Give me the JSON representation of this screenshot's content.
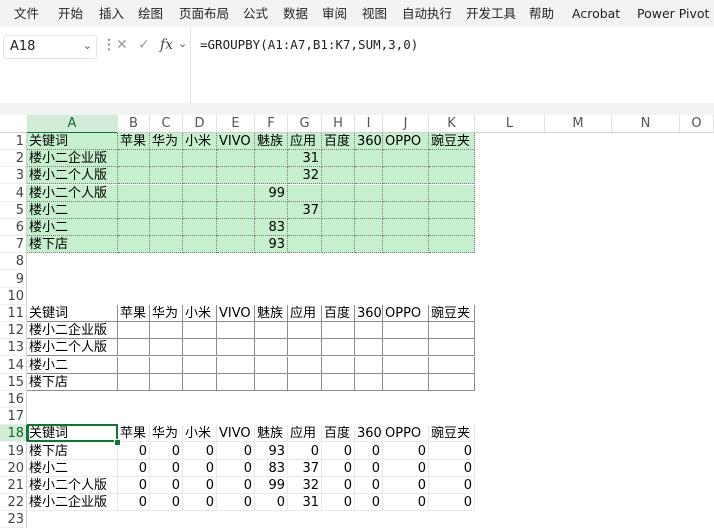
{
  "menu": {
    "items": [
      "文件",
      "开始",
      "插入",
      "绘图",
      "页面布局",
      "公式",
      "数据",
      "审阅",
      "视图",
      "自动执行",
      "开发工具",
      "帮助",
      "Acrobat",
      "Power Pivot"
    ]
  },
  "formula_bar": {
    "name_box": "A18",
    "fx_label": "fx",
    "formula": "=GROUPBY(A1:A7,B1:K7,SUM,3,0)"
  },
  "columns": [
    "A",
    "B",
    "C",
    "D",
    "E",
    "F",
    "G",
    "H",
    "I",
    "J",
    "K",
    "L",
    "M",
    "N",
    "O"
  ],
  "rows": [
    "1",
    "2",
    "3",
    "4",
    "5",
    "6",
    "7",
    "8",
    "9",
    "10",
    "11",
    "12",
    "13",
    "14",
    "15",
    "16",
    "17",
    "18",
    "19",
    "20",
    "21",
    "22",
    "23"
  ],
  "selected": {
    "column": "A",
    "row": "18"
  },
  "header_row": [
    "关键词",
    "苹果",
    "华为",
    "小米",
    "VIVO",
    "魅族",
    "应用",
    "百度",
    "360",
    "OPPO",
    "豌豆夹"
  ],
  "source_table": {
    "rows": [
      [
        "楼小二企业版",
        "",
        "",
        "",
        "",
        "",
        "31",
        "",
        "",
        "",
        ""
      ],
      [
        "楼小二个人版",
        "",
        "",
        "",
        "",
        "",
        "32",
        "",
        "",
        "",
        ""
      ],
      [
        "楼小二个人版",
        "",
        "",
        "",
        "",
        "99",
        "",
        "",
        "",
        "",
        ""
      ],
      [
        "楼小二",
        "",
        "",
        "",
        "",
        "",
        "37",
        "",
        "",
        "",
        ""
      ],
      [
        "楼小二",
        "",
        "",
        "",
        "",
        "83",
        "",
        "",
        "",
        "",
        ""
      ],
      [
        "楼下店",
        "",
        "",
        "",
        "",
        "93",
        "",
        "",
        "",
        "",
        ""
      ]
    ]
  },
  "blank_table": {
    "rows": [
      [
        "楼小二企业版"
      ],
      [
        "楼小二个人版"
      ],
      [
        "楼小二"
      ],
      [
        "楼下店"
      ]
    ]
  },
  "result_table": {
    "rows": [
      [
        "楼下店",
        "0",
        "0",
        "0",
        "0",
        "93",
        "0",
        "0",
        "0",
        "0",
        "0"
      ],
      [
        "楼小二",
        "0",
        "0",
        "0",
        "0",
        "83",
        "37",
        "0",
        "0",
        "0",
        "0"
      ],
      [
        "楼小二个人版",
        "0",
        "0",
        "0",
        "0",
        "99",
        "32",
        "0",
        "0",
        "0",
        "0"
      ],
      [
        "楼小二企业版",
        "0",
        "0",
        "0",
        "0",
        "0",
        "31",
        "0",
        "0",
        "0",
        "0"
      ]
    ]
  },
  "colors": {
    "accent": "#137333",
    "fill_green": "#c6efce",
    "header_selected_bg": "#d3ecd8"
  }
}
